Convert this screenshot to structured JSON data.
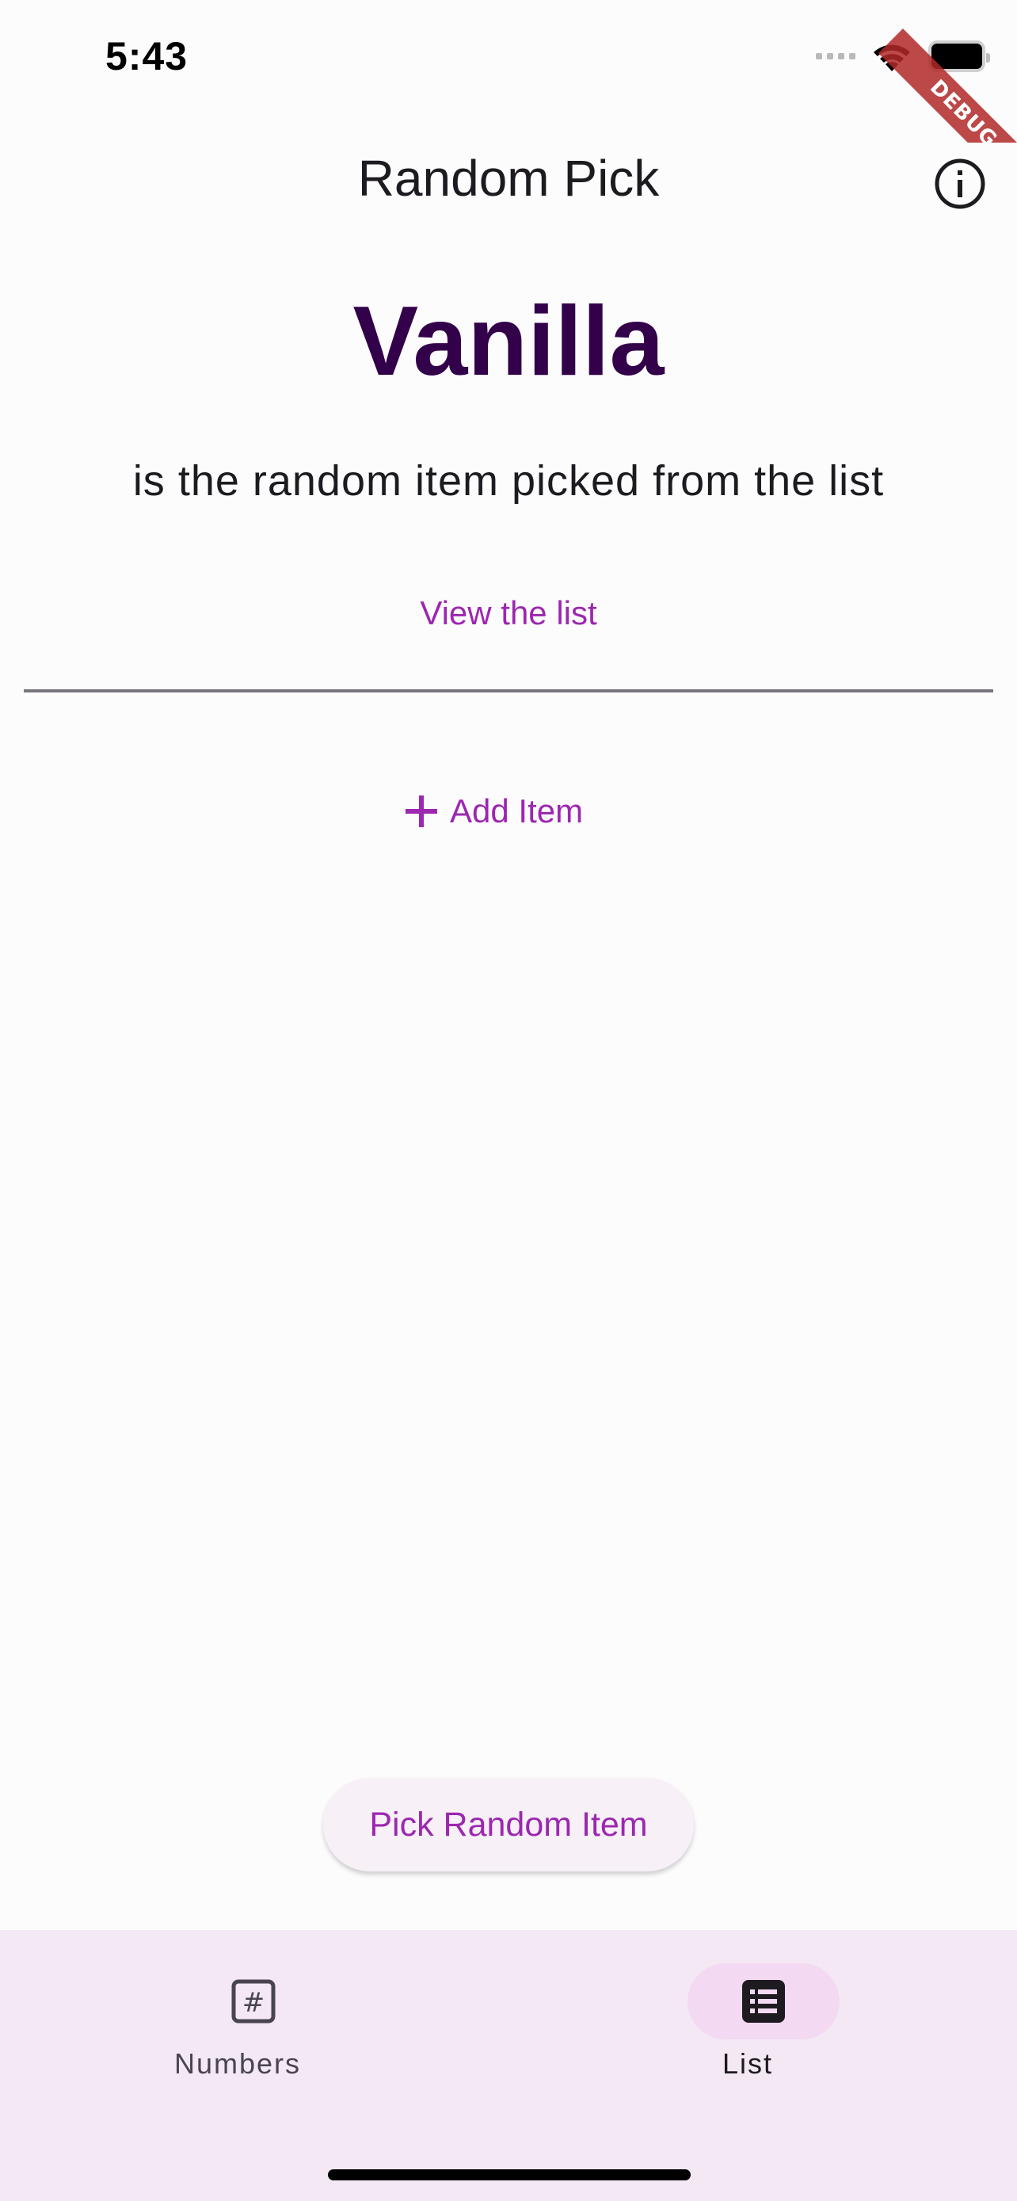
{
  "status_bar": {
    "time": "5:43",
    "icons": [
      "cellular-signal-icon",
      "wifi-icon",
      "battery-icon"
    ]
  },
  "debug_banner": {
    "label": "DEBUG",
    "color": "#b22828"
  },
  "app_bar": {
    "title": "Random Pick",
    "action_icon": "info-icon"
  },
  "result": {
    "item": "Vanilla",
    "subtitle": "is the random item picked from the list"
  },
  "actions": {
    "view_list_label": "View the list",
    "add_item_label": "Add Item",
    "add_item_icon": "plus-icon",
    "pick_label": "Pick Random Item"
  },
  "bottom_nav": {
    "items": [
      {
        "label": "Numbers",
        "icon": "hash-icon",
        "selected": false
      },
      {
        "label": "List",
        "icon": "list-icon",
        "selected": true
      }
    ]
  },
  "colors": {
    "accent": "#9c27b0",
    "result_text": "#33004a",
    "nav_background": "#f4e8f4",
    "nav_selected_pill": "#f3d9f1"
  }
}
